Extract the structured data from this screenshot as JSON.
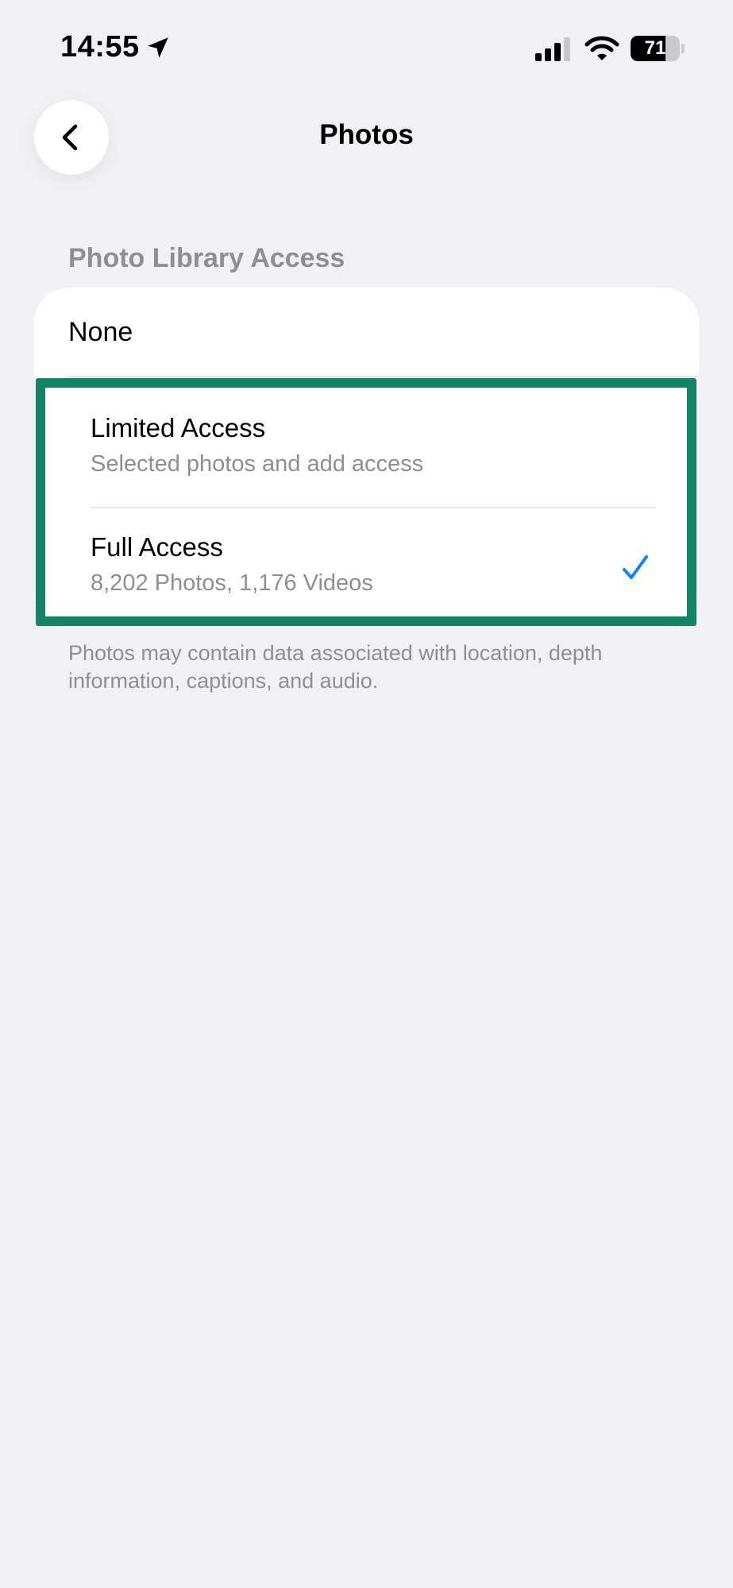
{
  "status_bar": {
    "time": "14:55",
    "battery_level": "71",
    "battery_fraction": 0.71,
    "location_icon": "location-arrow-icon",
    "signal_icon": "cellular-signal-icon",
    "wifi_icon": "wifi-icon"
  },
  "nav": {
    "back_icon": "chevron-left-icon",
    "title": "Photos"
  },
  "section": {
    "header": "Photo Library Access",
    "options": [
      {
        "label": "None",
        "subtitle": null,
        "selected": false
      },
      {
        "label": "Limited Access",
        "subtitle": "Selected photos and add access",
        "selected": false
      },
      {
        "label": "Full Access",
        "subtitle": "8,202 Photos, 1,176 Videos",
        "selected": true
      }
    ],
    "footer": "Photos may contain data associated with location, depth information, captions, and audio."
  },
  "colors": {
    "background": "#f0f0f5",
    "card": "#ffffff",
    "secondary_text": "#8e8e93",
    "checkmark": "#0a84ff",
    "highlight_border": "#128467"
  }
}
